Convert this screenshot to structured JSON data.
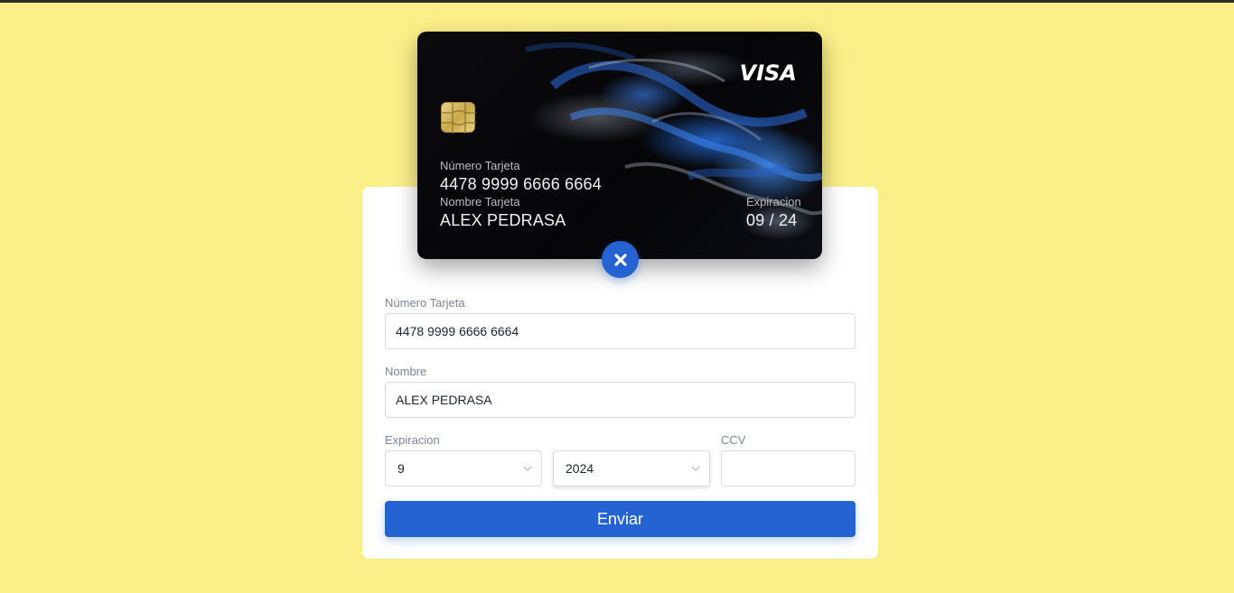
{
  "card": {
    "brand": "VISA",
    "number_label": "Número Tarjeta",
    "number": "4478 9999 6666 6664",
    "name_label": "Nombre Tarjeta",
    "name": "ALEX PEDRASA",
    "expiry_label": "Expiracion",
    "expiry": "09 / 24"
  },
  "form": {
    "number_label": "Número Tarjeta",
    "number_value": "4478 9999 6666 6664",
    "name_label": "Nombre",
    "name_value": "ALEX PEDRASA",
    "expiry_label": "Expiracion",
    "month_value": "9",
    "year_value": "2024",
    "ccv_label": "CCV",
    "ccv_value": "",
    "submit_label": "Enviar"
  },
  "icons": {
    "close": "close-icon",
    "chevron": "chevron-down-icon",
    "chip": "card-chip-icon"
  },
  "colors": {
    "background": "#fbef89",
    "accent": "#2563d3",
    "panel": "#ffffff"
  }
}
